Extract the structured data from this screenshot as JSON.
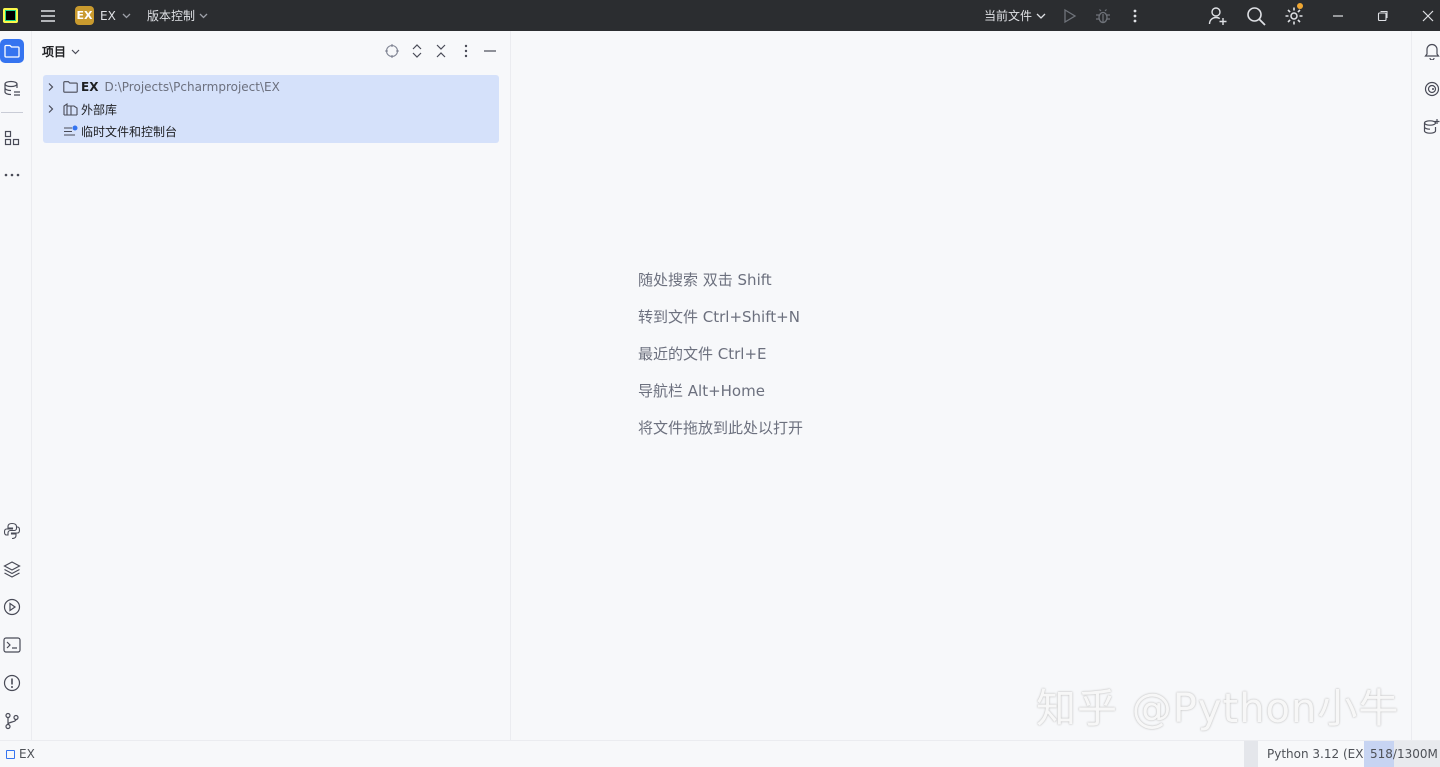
{
  "titlebar": {
    "project_badge": "EX",
    "project_name": "EX",
    "vcs_label": "版本控制",
    "run_config": "当前文件",
    "icons": [
      "app-logo-icon",
      "hamburger-menu-icon",
      "run-icon",
      "debug-icon",
      "more-vertical-icon",
      "add-user-icon",
      "search-icon",
      "settings-icon",
      "minimize-icon",
      "restore-icon",
      "close-icon"
    ]
  },
  "left_strip": {
    "icons": [
      "project-icon",
      "database-icon",
      "structure-icon",
      "more-horizontal-icon",
      "python-console-icon",
      "layers-icon",
      "services-icon",
      "terminal-icon",
      "problems-icon",
      "git-icon"
    ]
  },
  "project_panel": {
    "title": "项目",
    "tree": [
      {
        "name": "EX",
        "path": "D:\\Projects\\Pcharmproject\\EX",
        "icon": "folder-icon",
        "expandable": true
      },
      {
        "name": "外部库",
        "path": "",
        "icon": "library-icon",
        "expandable": true
      },
      {
        "name": "临时文件和控制台",
        "path": "",
        "icon": "scratches-icon",
        "expandable": false
      }
    ]
  },
  "editor": {
    "hints": [
      "随处搜索 双击 Shift",
      "转到文件 Ctrl+Shift+N",
      "最近的文件 Ctrl+E",
      "导航栏 Alt+Home",
      "将文件拖放到此处以打开"
    ]
  },
  "right_strip": {
    "icons": [
      "notifications-icon",
      "ai-spiral-icon",
      "database-ai-icon"
    ]
  },
  "watermark": "知乎 @Python小牛",
  "statusbar": {
    "project": "EX",
    "interpreter": "Python 3.12 (EX)",
    "memory": "518/1300M",
    "memory_used_fraction": 0.398
  },
  "colors": {
    "accent": "#3574f0",
    "titlebar_bg": "#2b2d30",
    "selection_bg": "#d5e1fa",
    "badge_bg": "#c99a2e"
  }
}
